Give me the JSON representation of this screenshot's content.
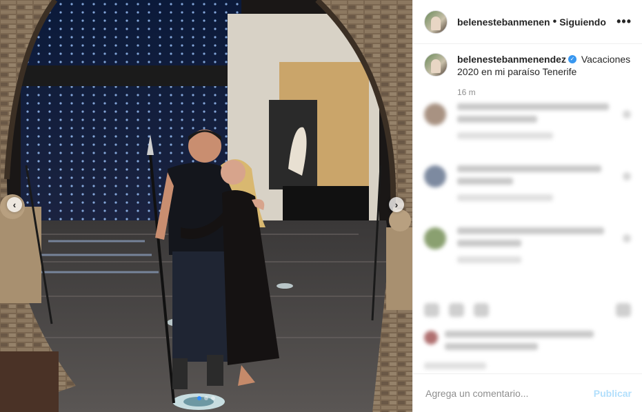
{
  "post": {
    "photo_alt": "",
    "nav_prev": "‹",
    "nav_next": "›",
    "dots": 3,
    "active_dot": 0
  },
  "header": {
    "username": "belenestebanmenen",
    "separator": "•",
    "follow_status": "Siguiendo",
    "more": "•••"
  },
  "caption": {
    "username": "belenestebanmenendez",
    "verified_mark": "✓",
    "text": "Vacaciones 2020 en mi paraíso Tenerife",
    "time": "16 m"
  },
  "comment_box": {
    "placeholder": "Agrega un comentario...",
    "publish_label": "Publicar"
  },
  "colors": {
    "link_disabled": "#b2dffc",
    "verified": "#3897f0",
    "muted": "#8e8e8e"
  }
}
